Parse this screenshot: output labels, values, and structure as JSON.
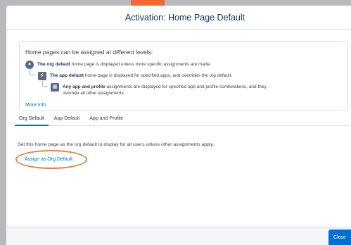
{
  "modal": {
    "title": "Activation: Home Page Default"
  },
  "info": {
    "intro": "Home pages can be assigned at different levels:",
    "levels": [
      {
        "bold": "The org default",
        "text": " home page is displayed unless more specific assignments are made.",
        "icon": "org-icon"
      },
      {
        "bold": "The app default",
        "text": " home page is displayed for specified apps, and overrides the org default.",
        "icon": "app-lightning-icon"
      },
      {
        "bold": "Any app and profile",
        "text": " assignments are displayed for specified app and profile combinations, and they override all other assignments.",
        "icon": "profile-icon"
      }
    ],
    "more_info": "More Info"
  },
  "tabs": [
    {
      "label": "Org Default",
      "active": true
    },
    {
      "label": "App Default",
      "active": false
    },
    {
      "label": "App and Profile",
      "active": false
    }
  ],
  "org_default": {
    "description": "Set this home page as the org default to display for all users unless other assignments apply.",
    "assign_label": "Assign as Org Default"
  },
  "footer": {
    "close_label": "Close"
  },
  "colors": {
    "accent": "#0070d2",
    "highlight": "#d9835a",
    "icon_bg": "#54698d"
  }
}
